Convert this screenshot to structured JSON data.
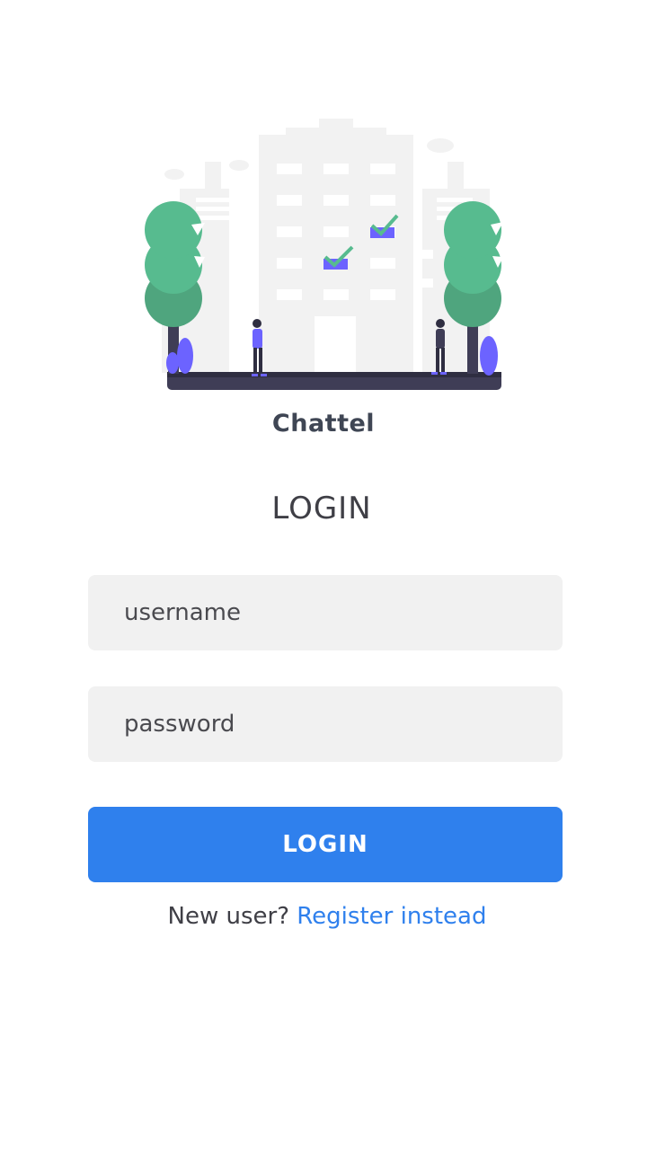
{
  "app": {
    "name": "Chattel"
  },
  "login": {
    "heading": "LOGIN",
    "username_placeholder": "username",
    "password_placeholder": "password",
    "submit_label": "LOGIN"
  },
  "register": {
    "prompt": "New user?",
    "link_label": "Register instead"
  },
  "colors": {
    "accent": "#2f80ed",
    "tree_green": "#57bb8f",
    "figure_purple": "#6c63ff"
  },
  "hero": {
    "icon": "city-login-illustration"
  }
}
